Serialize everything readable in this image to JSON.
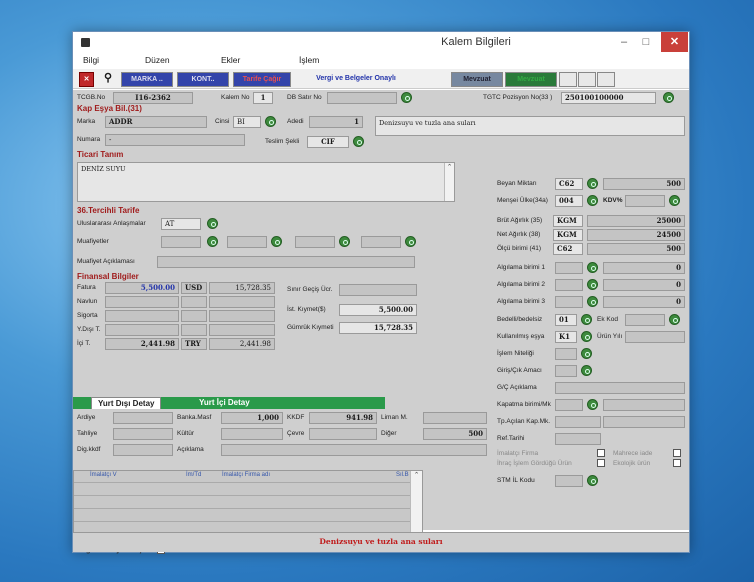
{
  "window": {
    "title": "Kalem Bilgileri",
    "min": "–",
    "max": "□",
    "close": "✕"
  },
  "menu": [
    "Bilgi",
    "Düzen",
    "Ekler",
    "İşlem"
  ],
  "toolbar": {
    "marka": "MARKA ..",
    "kont": "KONT..",
    "tarife": "Tarife Çağır",
    "vergi": "Vergi ve Belgeler Onaylı",
    "mevzuat": "Mevzuat",
    "mevzuat2": "Mevzuat"
  },
  "header": {
    "tcgb_label": "TCGB.No",
    "tcgb": "I16-2362",
    "kalem_label": "Kalem No",
    "kalem": "1",
    "db_label": "DB Satır No",
    "gtip_label": "TGTC Pozisyon No(33 )",
    "gtip": "250100100000"
  },
  "kap": {
    "section": "Kap Eşya Bil.(31)",
    "marka_label": "Marka",
    "marka": "ADDR",
    "cinsi_label": "Cinsi",
    "cinsi": "BI",
    "adedi_label": "Adedi",
    "adedi": "1",
    "numara_label": "Numara",
    "numara": "-",
    "teslim_label": "Teslim Şekli",
    "teslim": "CIF",
    "desc": "Denizsuyu ve tuzla ana suları"
  },
  "ticari": {
    "section": "Ticari Tanım",
    "text": "DENİZ SUYU"
  },
  "tercihli": {
    "section": "36.Tercihli Tarife",
    "anlasma_label": "Uluslararası Anlaşmalar",
    "anlasma": "AT",
    "muafiyet_label": "Muafiyetler",
    "muaf_acik_label": "Muafiyet Açıklaması"
  },
  "finansal": {
    "section": "Finansal Bilgiler",
    "fatura_label": "Fatura",
    "fatura": "5,500.00",
    "fatura_cur": "USD",
    "fatura_tl": "15,728.35",
    "navlun_label": "Navlun",
    "sigorta_label": "Sigorta",
    "ydigi_label": "Y.Dışı T.",
    "yici_label": "İçi T.",
    "yici": "2,441.98",
    "yici_cur": "TRY",
    "yici_tl": "2,441.98",
    "sinir_label": "Sınır Geçiş Ücr.",
    "ist_label": "İst. Kıymet($)",
    "ist": "5,500.00",
    "gumruk_label": "Gümrük Kıymeti",
    "gumruk": "15,728.35"
  },
  "right": {
    "beyan_label": "Beyan Miktarı",
    "beyan_unit": "C62",
    "beyan": "500",
    "mensei_label": "Menşei Ülke(34a)",
    "mensei": "004",
    "kdv_label": "KDV%",
    "brut_label": "Brüt Ağırlık (35)",
    "brut_unit": "KGM",
    "brut": "25000",
    "net_label": "Net Ağırlık (38)",
    "net_unit": "KGM",
    "net": "24500",
    "olcu_label": "Ölçü birimi (41)",
    "olcu_unit": "C62",
    "olcu": "500",
    "alg1": "Algılama birimi 1",
    "alg2": "Algılama birimi 2",
    "alg3": "Algılama birimi 3",
    "zero": "0",
    "bedelli_label": "Bedelli/bedelsiz",
    "bedelli": "01",
    "ekkod_label": "Ek Kod",
    "kullanilmis_label": "Kullanılmış eşya",
    "kullanilmis": "K1",
    "urunyili_label": "Ürün Yılı",
    "islem_label": "İşlem Niteliği",
    "giris_label": "Giriş/Çık Amacı",
    "gc_label": "G/Ç Açıklama",
    "kapatma_label": "Kapatma birimi/Mk",
    "tpacilan_label": "Tp.Açılan Kap.Mk.",
    "ref_label": "Ref.Tarihi",
    "imalatci_label": "İmalatçı Firma",
    "mahrece_label": "Mahrece iade",
    "ihrac_label": "İhraç İşlem Gördüğü Ürün",
    "ekolojik_label": "Ekolojik ürün",
    "stm_label": "STM İL Kodu"
  },
  "tabs": {
    "dis": "Yurt Dışı Detay",
    "ic": "Yurt İçi Detay"
  },
  "detay": {
    "ardiye": "Ardiye",
    "banka": "Banka.Masf",
    "banka_val": "1,000",
    "kkdf": "KKDF",
    "kkdf_val": "941.98",
    "liman": "Liman M.",
    "tahliye": "Tahliye",
    "kultur": "Kültür",
    "cevre": "Çevre",
    "diger": "Diğer",
    "diger_val": "500",
    "dig": "Dig.kkdf",
    "aciklama": "Açıklama"
  },
  "grid": {
    "cols": [
      "İmalatçı V",
      "İm/Td",
      "İmalatçı Firma adı",
      "Sıl.B"
    ]
  },
  "footer": {
    "onay_label": "Bilgiler Onaylanmış",
    "check": "✓",
    "status": "Denizsuyu ve tuzla ana suları"
  },
  "colors": {
    "accent": "#2a9a4a",
    "label_red": "#a01c1c",
    "status_red": "#c01c1c"
  }
}
